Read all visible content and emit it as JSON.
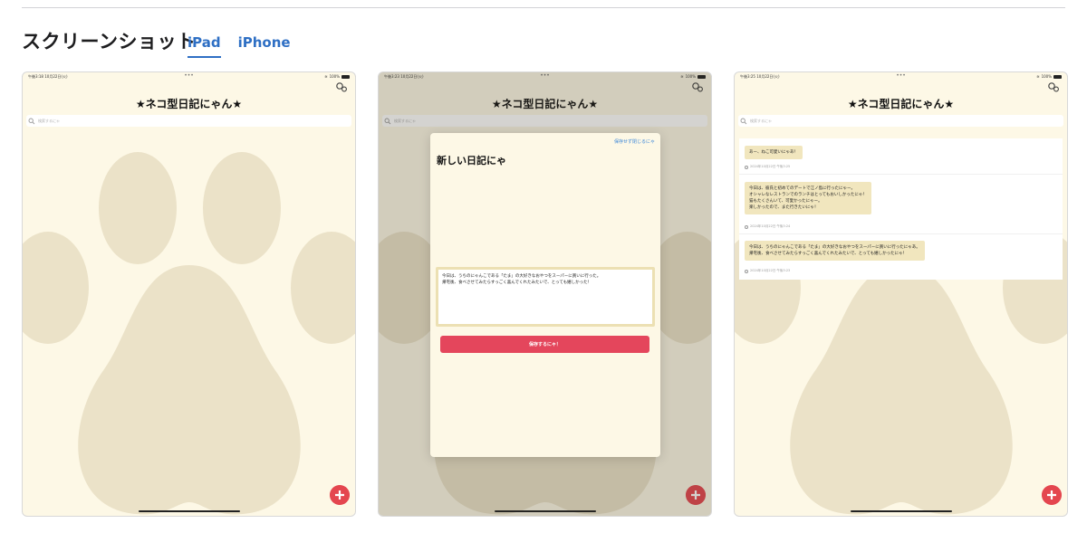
{
  "section": {
    "title": "スクリーンショット",
    "tabs": [
      {
        "label": "iPad",
        "active": true
      },
      {
        "label": "iPhone",
        "active": false
      }
    ]
  },
  "colors": {
    "link": "#2e6fc4",
    "app_background": "#fdf8e6",
    "paw": "#ebe2c8",
    "accent_red": "#e4464f",
    "bubble": "#f1e6be"
  },
  "screens": [
    {
      "status_time": "午後3:18 10月22日(火)",
      "status_battery": "100%",
      "app_title": "★ネコ型日記にゃん★",
      "search_placeholder": "検索するにゃ"
    },
    {
      "status_time": "午後3:23 10月22日(火)",
      "status_battery": "100%",
      "app_title": "★ネコ型日記にゃん★",
      "search_placeholder": "検索するにゃ",
      "modal": {
        "close_label": "保存せず閉じるにゃ",
        "title": "新しい日記にゃ",
        "editor_line1": "今日は、うちのにゃんこである「たま」の大好きなおやつをスーパーに買いに行った。",
        "editor_line2": "帰宅後、食べさせてみたらすっごく喜んでくれたみたいで、とっても嬉しかった！",
        "save_label": "保存するにゃ！"
      }
    },
    {
      "status_time": "午後3:25 10月22日(火)",
      "status_battery": "100%",
      "app_title": "★ネコ型日記にゃん★",
      "search_placeholder": "検索するにゃ",
      "entries": [
        {
          "lines": [
            "あー、ねこ可愛いにゃあ！"
          ],
          "date": "2024年10月22日 午後3:25"
        },
        {
          "lines": [
            "今日は、彼氏と初めてのデートで江ノ島に行ったにゃー。",
            "オシャレなレストランでのランチはとってもおいしかったにゃ！",
            "猫もたくさんいて、可愛かったにゃー。",
            "楽しかったので、また行きたいにゃ！"
          ],
          "date": "2024年10月22日 午後3:24"
        },
        {
          "lines": [
            "今日は、うちのにゃんこである「たま」の大好きなおやつをスーパーに買いに行ったにゃあ。",
            "帰宅後、食べさせてみたらすっごく喜んでくれたみたいで、とっても嬉しかったにゃ！"
          ],
          "date": "2024年10月22日 午後3:23"
        }
      ]
    }
  ]
}
